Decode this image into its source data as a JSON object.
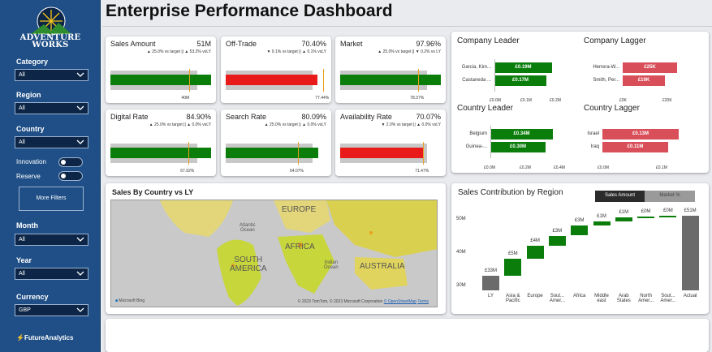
{
  "brand": {
    "name_line1": "ADVENTURE",
    "name_line2": "WORKS",
    "footer": "FutureAnalytics"
  },
  "header": {
    "title": "Enterprise Performance Dashboard"
  },
  "filters": {
    "category": {
      "label": "Category",
      "value": "All"
    },
    "region": {
      "label": "Region",
      "value": "All"
    },
    "country": {
      "label": "Country",
      "value": "All"
    },
    "innovation": {
      "label": "Innovation"
    },
    "reserve": {
      "label": "Reserve"
    },
    "more_filters": "More Filters",
    "month": {
      "label": "Month",
      "value": "All"
    },
    "year": {
      "label": "Year",
      "value": "All"
    },
    "currency": {
      "label": "Currency",
      "value": "GBP"
    }
  },
  "kpis": [
    {
      "name": "Sales Amount",
      "value": "51M",
      "sub": "▲ 25.0% vs target || ▲ 53.2% vsLY",
      "target_label": "40M",
      "status": "green",
      "fill": 1.0,
      "target": 0.81
    },
    {
      "name": "Off-Trade",
      "value": "70.40%",
      "sub": "▼ 9.1% vs target || ▲ 0.1% vsLY",
      "target_label": "77.44%",
      "status": "red",
      "fill": 0.91,
      "target": 1.0
    },
    {
      "name": "Market",
      "value": "97.96%",
      "sub": "▲ 25.0% vs target || ▼ 0.2% vs LY",
      "target_label": "78.37%",
      "status": "green",
      "fill": 1.0,
      "target": 0.8
    },
    {
      "name": "Digital Rate",
      "value": "84.90%",
      "sub": "▲ 25.0% vs target || ▲ 0.0% vsLY",
      "target_label": "67.92%",
      "status": "green",
      "fill": 1.0,
      "target": 0.8
    },
    {
      "name": "Search Rate",
      "value": "80.09%",
      "sub": "▲ 25.0% vs target || ▲ 0.0% vsLY",
      "target_label": "64.07%",
      "status": "green",
      "fill": 0.92,
      "target": 0.74
    },
    {
      "name": "Availability Rate",
      "value": "70.07%",
      "sub": "▼ 2.0% vs target || ▲ 0.0% vsLY",
      "target_label": "71.47%",
      "status": "red",
      "fill": 0.83,
      "target": 0.85
    }
  ],
  "company_leader": {
    "title": "Company Leader",
    "rows": [
      {
        "name": "Garcia, Kim...",
        "value": "£0.19M"
      },
      {
        "name": "Castaneda ...",
        "value": "£0.17M"
      }
    ],
    "ticks": [
      "£0.0M",
      "£0.1M",
      "£0.2M"
    ]
  },
  "company_lagger": {
    "title": "Company Lagger",
    "rows": [
      {
        "name": "Herrera-W...",
        "value": "£25K"
      },
      {
        "name": "Smith, Per...",
        "value": "£19K"
      }
    ],
    "ticks": [
      "£0K",
      "£20K"
    ]
  },
  "country_leader": {
    "title": "Country Leader",
    "rows": [
      {
        "name": "Belgium",
        "value": "£0.34M"
      },
      {
        "name": "Guinea-...",
        "value": "£0.30M"
      }
    ],
    "ticks": [
      "£0.0M",
      "£0.2M",
      "£0.4M"
    ]
  },
  "country_lagger": {
    "title": "Country Lagger",
    "rows": [
      {
        "name": "Israel",
        "value": "£0.13M"
      },
      {
        "name": "Iraq",
        "value": "£0.11M"
      }
    ],
    "ticks": [
      "£0.0M",
      "£0.1M"
    ]
  },
  "map": {
    "title": "Sales By Country vs LY",
    "labels": {
      "europe": "EUROPE",
      "africa": "AFRICA",
      "south_america_1": "SOUTH",
      "south_america_2": "AMERICA",
      "australia": "AUSTRALIA",
      "atlantic_1": "Atlantic",
      "atlantic_2": "Ocean",
      "indian_1": "Indian",
      "indian_2": "Ocean"
    },
    "bing": "Microsoft Bing",
    "credit": "© 2023 TomTom, © 2023 Microsoft Corporation",
    "credit_osm": "© OpenStreetMap",
    "credit_terms": "Terms"
  },
  "waterfall": {
    "title": "Sales Contribution by Region",
    "toggle_active": "Sales Amount",
    "toggle_inactive": "Market %",
    "y_ticks": [
      "50M",
      "40M",
      "30M"
    ],
    "bars": [
      {
        "label": "LY",
        "value": "£33M"
      },
      {
        "label": "Asia & Pacific",
        "value": "£5M"
      },
      {
        "label": "Europe",
        "value": "£4M"
      },
      {
        "label": "Sout... Amer...",
        "value": "£3M"
      },
      {
        "label": "Africa",
        "value": "£3M"
      },
      {
        "label": "Middle east",
        "value": "£1M"
      },
      {
        "label": "Arab States",
        "value": "£1M"
      },
      {
        "label": "North Amer...",
        "value": "£0M"
      },
      {
        "label": "Sout... Amer...",
        "value": "£0M"
      },
      {
        "label": "Actual",
        "value": "£51M"
      }
    ]
  },
  "colors": {
    "green": "#0b7d0b",
    "red": "#e81a1a",
    "lagger": "#d94f59",
    "gray": "#6b6b6b",
    "sidebar": "#1f4f86"
  }
}
